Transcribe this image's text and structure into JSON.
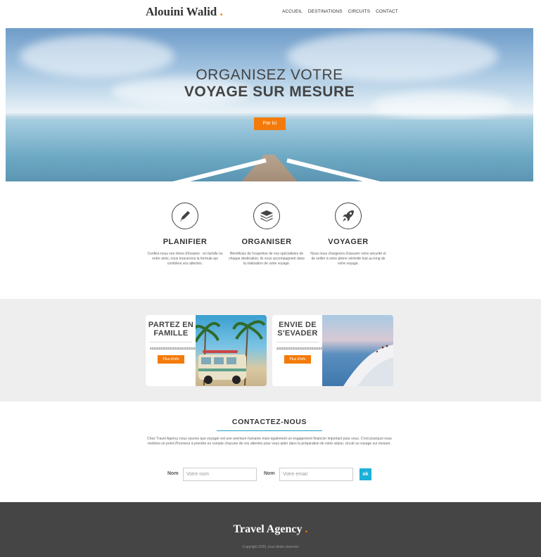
{
  "header": {
    "logo": "Alouini Walid",
    "logo_dot": ".",
    "nav": [
      "ACCUEIL",
      "DESTINATIONS",
      "CIRCUITS",
      "CONTACT"
    ]
  },
  "hero": {
    "title_line1": "ORGANISEZ VOTRE",
    "title_line2": "VOYAGE SUR MESURE",
    "button": "Par ici"
  },
  "features": [
    {
      "icon": "pencil-icon",
      "title": "PLANIFIER",
      "text": "Confiez-nous vos rêves d'évasion : en famille ou entre amis, nous trouverons la formule qui comblera vos attentes."
    },
    {
      "icon": "layers-icon",
      "title": "ORGANISER",
      "text": "Bénéficiez de l'expertise de nos spécialistes de chaque destination, ils vous accompagnent dans la réalisation de votre voyage."
    },
    {
      "icon": "rocket-icon",
      "title": "VOYAGER",
      "text": "Nous nous chargeons d'assurer votre sécurité et de veiller à votre pleine sérénité tout au long de votre voyage."
    }
  ],
  "cards": [
    {
      "title": "PARTEZ EN FAMILLE",
      "filler": "zzzzzzzzzzzzzzzzzzzzzzzzzzzz",
      "button": "Plus d'info"
    },
    {
      "title": "ENVIE DE S'EVADER",
      "filler": "zzzzzzzzzzzzzzzzzzzzzzzzzzzzzzzzzzzzz",
      "button": "Plus d'info"
    }
  ],
  "contact": {
    "title": "CONTACTEZ-NOUS",
    "text": "Chez Travel Agency nous savons que voyager est une aventure humaine mais également un engagement financier important pour vous. C'est pourquoi nous mettons un point d'honneur à prendre en compte chacune de vos attentes pour vous aider dans la préparation de votre séjour, circuit ou voyage sur mesure.",
    "label_name": "Nom",
    "placeholder_name": "Votre nom",
    "label_email": "Nom",
    "placeholder_email": "Votre email",
    "submit": "ok"
  },
  "footer": {
    "title": "Travel Agency",
    "title_dot": ".",
    "copyright": "Copyright 2020, tous droits réservés"
  },
  "colors": {
    "accent": "#f47b0b",
    "contact_accent": "#1ab0d9",
    "footer_bg": "#454545"
  }
}
